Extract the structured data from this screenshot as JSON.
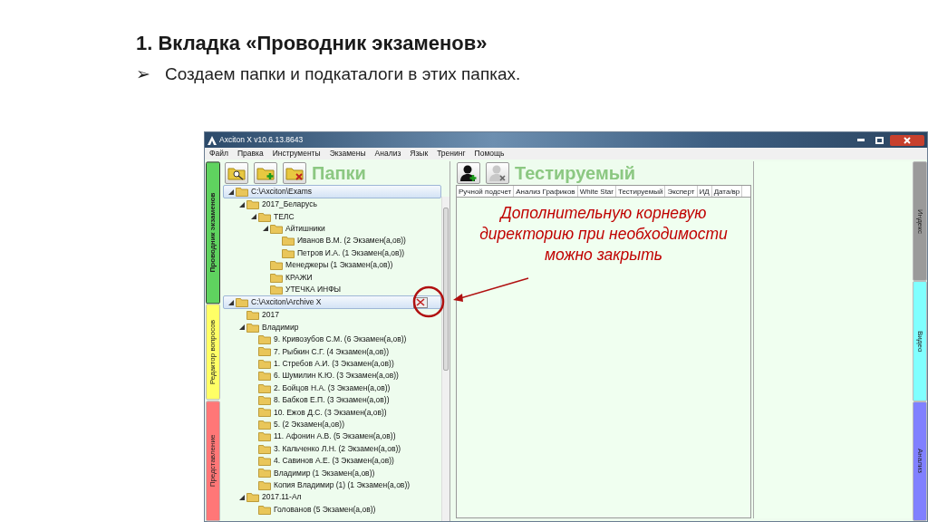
{
  "slide": {
    "title": "1. Вкладка «Проводник экзаменов»",
    "bullet_marker": "➢",
    "bullet": "Создаем папки и подкаталоги в этих папках."
  },
  "window": {
    "title": "Axciton X v10.6.13.8643"
  },
  "menu": [
    "Файл",
    "Правка",
    "Инструменты",
    "Экзамены",
    "Анализ",
    "Язык",
    "Тренинг",
    "Помощь"
  ],
  "left_tabs": [
    {
      "label": "Проводник экзаменов",
      "color": "#5fd35f",
      "selected": true
    },
    {
      "label": "Редактор вопросов",
      "color": "#ffff66",
      "selected": false
    },
    {
      "label": "Представление",
      "color": "#ff7777",
      "selected": false
    }
  ],
  "folders_panel": {
    "title": "Папки",
    "tree": [
      {
        "label": "C:\\Axciton\\Exams",
        "expanded": true,
        "closable": false,
        "children": [
          {
            "label": "2017_Беларусь",
            "expanded": true,
            "children": [
              {
                "label": "ТЕЛС",
                "expanded": true,
                "children": [
                  {
                    "label": "Айтишники",
                    "expanded": true,
                    "children": [
                      {
                        "label": "Иванов В.М.  (2 Экзамен(а,ов))"
                      },
                      {
                        "label": "Петров И.А.  (1 Экзамен(а,ов))"
                      }
                    ]
                  },
                  {
                    "label": "Менеджеры  (1 Экзамен(а,ов))"
                  },
                  {
                    "label": "КРАЖИ"
                  },
                  {
                    "label": "УТЕЧКА ИНФЫ"
                  }
                ]
              }
            ]
          }
        ]
      },
      {
        "label": "C:\\Axciton\\Archive X",
        "expanded": true,
        "closable": true,
        "children": [
          {
            "label": "2017"
          },
          {
            "label": "Владимир",
            "expanded": true,
            "children": [
              {
                "label": "9. Кривозубов С.М.  (6 Экзамен(а,ов))"
              },
              {
                "label": "7.  Рыбкин С.Г.  (4 Экзамен(а,ов))"
              },
              {
                "label": "1. Стребов А.И.  (3 Экзамен(а,ов))"
              },
              {
                "label": "6. Шумилин К.Ю.   (3 Экзамен(а,ов))"
              },
              {
                "label": "2. Бойцов Н.А.  (3 Экзамен(а,ов))"
              },
              {
                "label": "8. Бабков Е.П.  (3 Экзамен(а,ов))"
              },
              {
                "label": "10. Ежов Д.С.  (3 Экзамен(а,ов))"
              },
              {
                "label": "5.   (2 Экзамен(а,ов))"
              },
              {
                "label": "11. Афонин А.В.  (5 Экзамен(а,ов))"
              },
              {
                "label": "3. Кальченко Л.Н.  (2 Экзамен(а,ов))"
              },
              {
                "label": "4. Савинов А.Е.  (3 Экзамен(а,ов))"
              },
              {
                "label": "Владимир  (1 Экзамен(а,ов))"
              },
              {
                "label": "Копия Владимир (1)  (1 Экзамен(а,ов))"
              }
            ]
          },
          {
            "label": "2017.11-Ал",
            "expanded": true,
            "children": [
              {
                "label": "Голованов  (5 Экзамен(а,ов))"
              }
            ]
          }
        ]
      }
    ]
  },
  "examinee_panel": {
    "title": "Тестируемый",
    "toolbar": [
      {
        "kind": "add",
        "disabled": false
      },
      {
        "kind": "remove",
        "disabled": true
      }
    ],
    "columns": [
      "Ручной подсчет",
      "Анализ Графиков",
      "White Star",
      "Тестируемый",
      "Эксперт",
      "ИД",
      "Дата/вр"
    ]
  },
  "annotation_lines": [
    "Дополнительную корневую",
    "директорию при необходимости",
    "можно закрыть"
  ],
  "right_tabs": [
    {
      "label": "Индекс",
      "color": "#9a9a9a",
      "selected": false
    },
    {
      "label": "Видео",
      "color": "#80ffff",
      "selected": false
    },
    {
      "label": "Анализ",
      "color": "#8080ff",
      "selected": false
    }
  ]
}
